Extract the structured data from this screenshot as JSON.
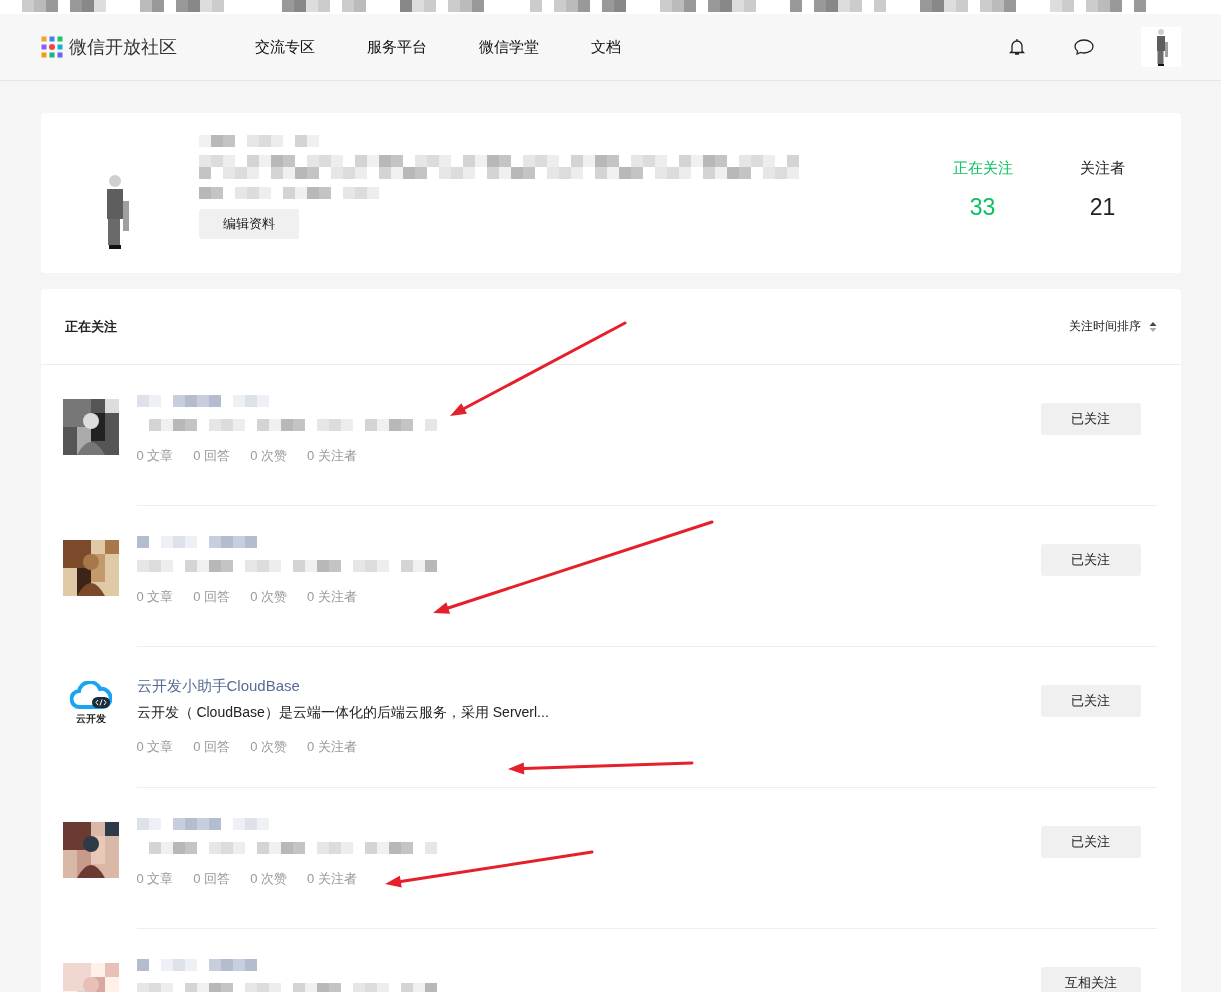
{
  "bookmarks_bar": [
    {
      "kind": "blurred"
    },
    {
      "kind": "blurred"
    },
    {
      "kind": "blurred"
    },
    {
      "kind": "blurred"
    },
    {
      "kind": "blurred"
    },
    {
      "kind": "blurred"
    },
    {
      "kind": "blurred"
    },
    {
      "kind": "blurred"
    },
    {
      "kind": "blurred"
    }
  ],
  "nav": {
    "logo_text": "微信开放社区",
    "items": [
      {
        "label": "交流专区",
        "selected": false
      },
      {
        "label": "服务平台",
        "selected": false
      },
      {
        "label": "微信学堂",
        "selected": false
      },
      {
        "label": "文档",
        "selected": false
      }
    ],
    "avatar": {
      "kind": "picture"
    }
  },
  "profile": {
    "avatar": {
      "kind": "picture"
    },
    "kind": "blurred",
    "edit_button": "编辑资料",
    "stats": [
      {
        "label": "正在关注",
        "value": "33",
        "selected": true
      },
      {
        "label": "关注者",
        "value": "21",
        "selected": false
      }
    ]
  },
  "following": {
    "title": "正在关注",
    "sort_label": "关注时间排序",
    "rows": [
      {
        "kind": "blurred",
        "avatar": {
          "kind": "picture"
        },
        "stats": [
          "0 文章",
          "0 回答",
          "0 次赞",
          "0 关注者"
        ],
        "button": "已关注"
      },
      {
        "kind": "blurred",
        "avatar": {
          "kind": "picture"
        },
        "stats": [
          "0 文章",
          "0 回答",
          "0 次赞",
          "0 关注者"
        ],
        "button": "已关注"
      },
      {
        "kind": "plain",
        "avatar": {
          "kind": "logo",
          "text": "云开发"
        },
        "name": "云开发小助手CloudBase",
        "description": "云开发（ CloudBase）是云端一体化的后端云服务，采用 Serverl...",
        "stats": [
          "0 文章",
          "0 回答",
          "0 次赞",
          "0 关注者"
        ],
        "button": "已关注"
      },
      {
        "kind": "blurred",
        "avatar": {
          "kind": "picture"
        },
        "stats": [
          "0 文章",
          "0 回答",
          "0 次赞",
          "0 关注者"
        ],
        "button": "已关注"
      },
      {
        "kind": "blurred",
        "avatar": {
          "kind": "picture"
        },
        "button": "互相关注"
      }
    ]
  },
  "annotations": [
    {
      "kind": "arrow"
    },
    {
      "kind": "arrow"
    },
    {
      "kind": "arrow"
    },
    {
      "kind": "arrow"
    }
  ]
}
